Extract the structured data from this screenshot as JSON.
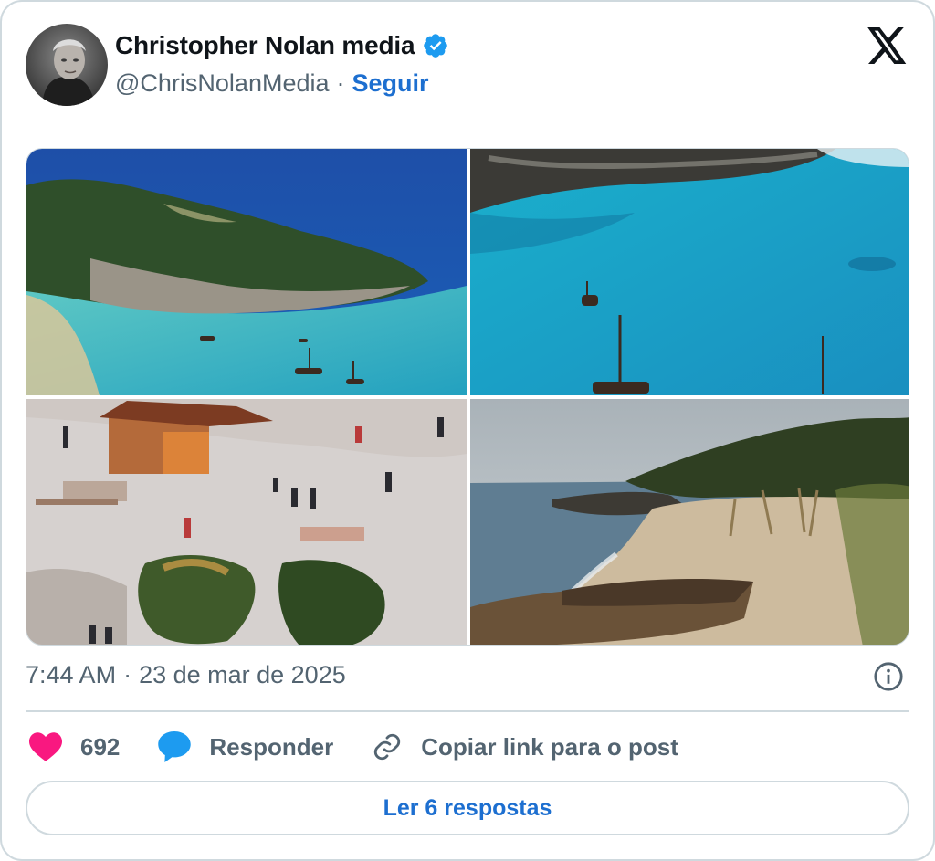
{
  "author": {
    "name": "Christopher Nolan media",
    "handle": "@ChrisNolanMedia",
    "separator": "·",
    "follow_label": "Seguir",
    "verified": true
  },
  "brand": {
    "logo": "x-logo-icon"
  },
  "media": [
    {
      "name": "island-cove-aerial"
    },
    {
      "name": "turquoise-bay-boats"
    },
    {
      "name": "village-set-people"
    },
    {
      "name": "beach-wooden-boat"
    }
  ],
  "post": {
    "time": "7:44 AM",
    "separator": "·",
    "date": "23 de mar de 2025"
  },
  "actions": {
    "likes_count": "692",
    "reply_label": "Responder",
    "copy_link_label": "Copiar link para o post"
  },
  "replies_button": "Ler 6 respostas",
  "colors": {
    "accent": "#1d6fd0",
    "heart": "#f91880",
    "verified": "#1d9bf0",
    "muted": "#536471",
    "border": "#cfd9de"
  }
}
